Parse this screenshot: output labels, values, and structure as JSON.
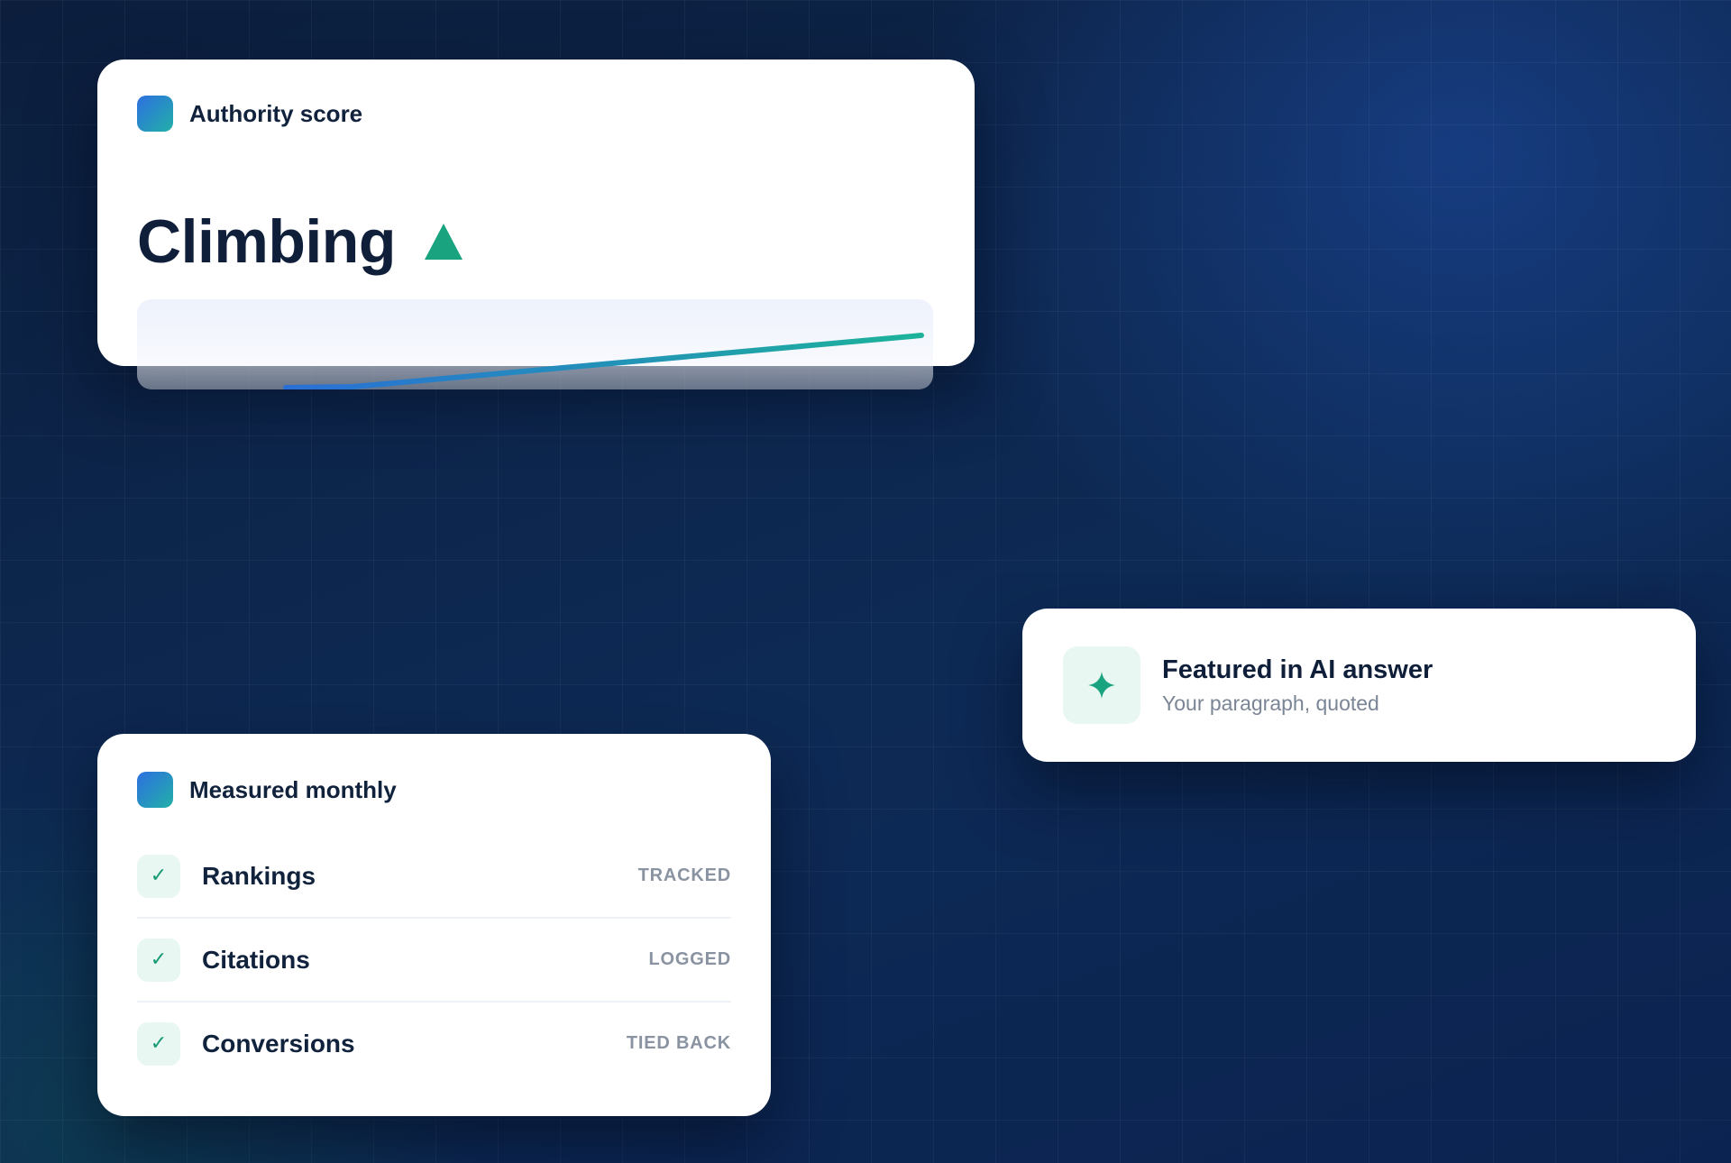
{
  "authority": {
    "label": "Authority score",
    "headline": "Climbing",
    "trend_icon": "triangle-up-icon",
    "trend_color": "#1aa37f"
  },
  "featured": {
    "icon": "sparkle-icon",
    "title": "Featured in AI answer",
    "subtitle": "Your paragraph, quoted"
  },
  "measured": {
    "label": "Measured monthly",
    "rows": [
      {
        "label": "Rankings",
        "status": "TRACKED",
        "icon": "check-icon"
      },
      {
        "label": "Citations",
        "status": "LOGGED",
        "icon": "check-icon"
      },
      {
        "label": "Conversions",
        "status": "TIED BACK",
        "icon": "check-icon"
      }
    ]
  },
  "colors": {
    "accent_blue": "#2d6fe0",
    "accent_teal": "#22b0a8",
    "success_green": "#1aa37f",
    "text_dark": "#0f1f3a",
    "text_muted": "#8a93a1"
  }
}
